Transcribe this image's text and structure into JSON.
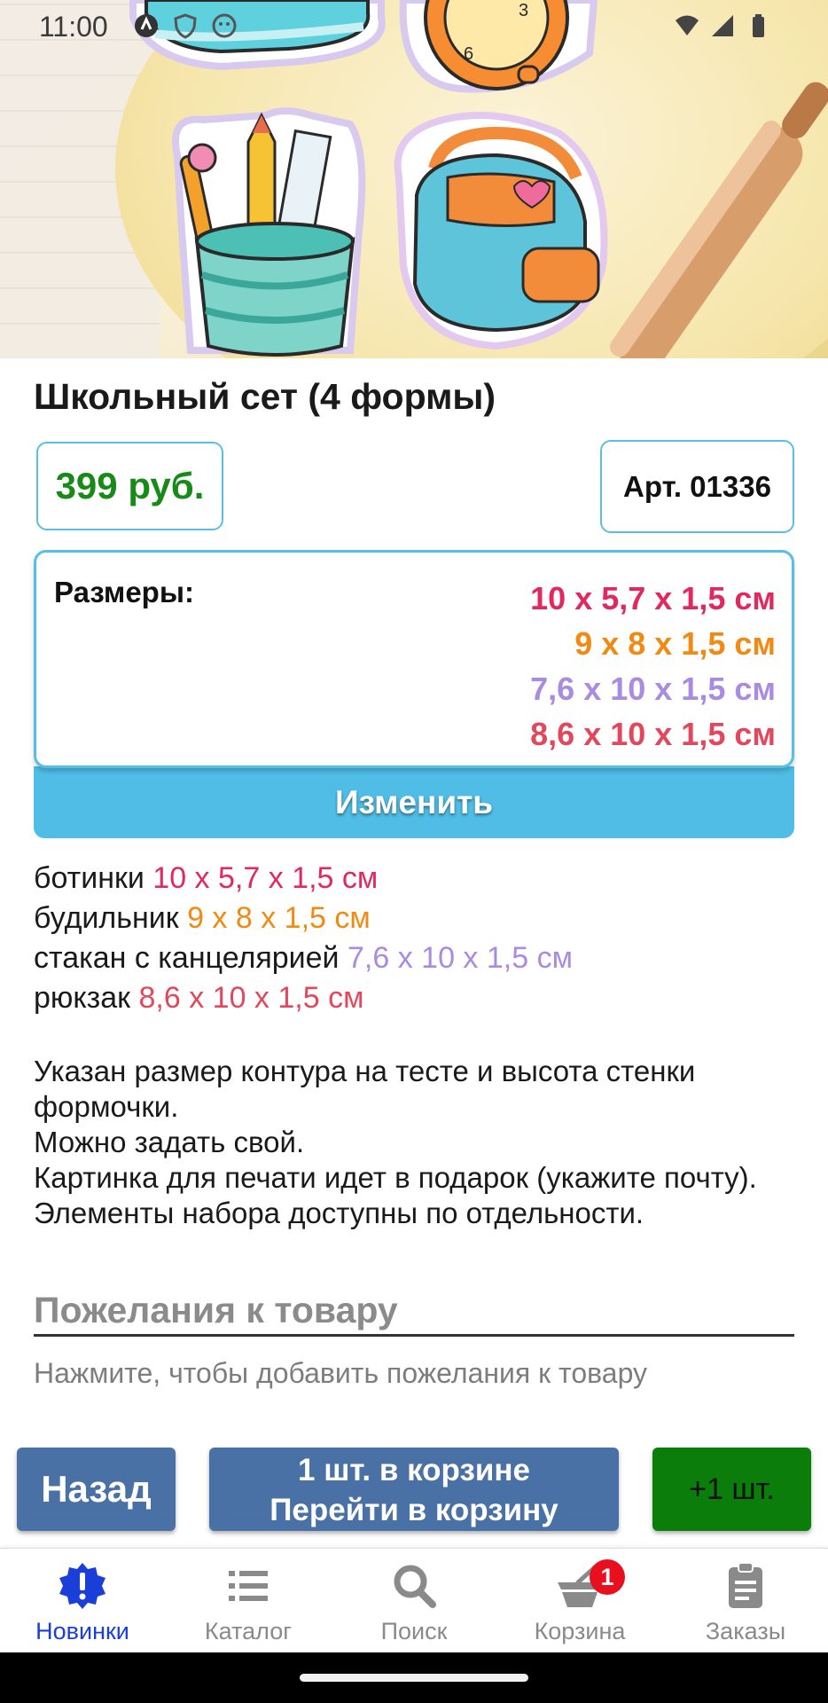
{
  "status_bar": {
    "time": "11:00"
  },
  "product": {
    "title": "Школьный сет (4 формы)",
    "price": "399 руб.",
    "article": "Арт. 01336"
  },
  "sizes": {
    "label": "Размеры:",
    "values": [
      {
        "text": "10 х 5,7 х 1,5 см",
        "color": "#e2295f"
      },
      {
        "text": "9 х 8 х 1,5 см",
        "color": "#f08a12"
      },
      {
        "text": "7,6 х 10 х 1,5 см",
        "color": "#a98be0"
      },
      {
        "text": "8,6 х 10 х 1,5 см",
        "color": "#e3475b"
      }
    ],
    "change_label": "Изменить"
  },
  "items": [
    {
      "name": "ботинки",
      "size": "10 х 5,7 х 1,5 см",
      "color": "#e2295f"
    },
    {
      "name": "будильник",
      "size": "9 х 8 х 1,5 см",
      "color": "#f08a12"
    },
    {
      "name": "стакан с канцелярией",
      "size": "7,6 х 10 х 1,5 см",
      "color": "#a98be0"
    },
    {
      "name": "рюкзак",
      "size": "8,6 х 10 х 1,5 см",
      "color": "#e3475b"
    }
  ],
  "description": [
    "Указан размер контура на тесте и высота стенки формочки.",
    "Можно задать свой.",
    "Картинка для печати идет в подарок (укажите почту).",
    "Элементы набора доступны по отдельности."
  ],
  "wishes": {
    "title": "Пожелания к товару",
    "hint": "Нажмите, чтобы добавить пожелания к товару"
  },
  "actions": {
    "back": "Назад",
    "cart_line1": "1 шт. в корзине",
    "cart_line2": "Перейти в корзину",
    "plus_one": "+1 шт."
  },
  "tabs": [
    {
      "label": "Новинки",
      "icon": "new-badge-icon",
      "active": true
    },
    {
      "label": "Каталог",
      "icon": "list-icon",
      "active": false
    },
    {
      "label": "Поиск",
      "icon": "search-icon",
      "active": false
    },
    {
      "label": "Корзина",
      "icon": "basket-icon",
      "active": false,
      "badge": "1"
    },
    {
      "label": "Заказы",
      "icon": "clipboard-icon",
      "active": false
    }
  ],
  "colors": {
    "accent": "#4fbde6",
    "price": "#178a17",
    "button_blue": "#4a71a6",
    "button_green": "#0b7d0b",
    "active_tab": "#1a3fd9",
    "badge": "#e8101e"
  }
}
